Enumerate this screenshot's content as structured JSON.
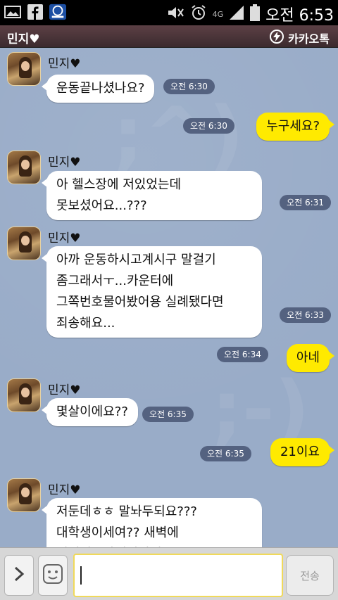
{
  "status": {
    "time": "오전 6:53",
    "network": "4G",
    "left_icons": [
      "image-icon",
      "facebook-icon",
      "news-app-icon"
    ],
    "right_icons": [
      "mute-icon",
      "alarm-icon",
      "signal-icon",
      "battery-icon"
    ]
  },
  "header": {
    "title": "민지♥",
    "app_name": "카카오톡",
    "app_icon": "kakaotalk-bolt-icon"
  },
  "messages": [
    {
      "sender": "민지♥",
      "text": "운동끝나셨나요?",
      "time": "오전 6:30"
    },
    {
      "sender": "me",
      "text": "누구세요?",
      "time": "오전 6:30"
    },
    {
      "sender": "민지♥",
      "text": "아 헬스장에 저있었는데\n못보셨어요...???",
      "time": "오전 6:31"
    },
    {
      "sender": "민지♥",
      "text": "아까 운동하시고계시구 말걸기\n좀그래서ㅜ...카운터에\n그쪽번호물어봤어용 실례됐다면\n죄송해요...",
      "time": "오전 6:33"
    },
    {
      "sender": "me",
      "text": "아네",
      "time": "오전 6:34"
    },
    {
      "sender": "민지♥",
      "text": "몇살이에요??",
      "time": "오전 6:35"
    },
    {
      "sender": "me",
      "text": "21이요",
      "time": "오전 6:35"
    },
    {
      "sender": "민지♥",
      "text": "저둔데ㅎㅎ 말놔두되요???\n대학생이세여?? 새벽에\n어쩌피트바에여덧데",
      "time": ""
    }
  ],
  "input": {
    "value": "",
    "send_label": "전송",
    "expand_icon": "chevron-right-icon",
    "emoticon_icon": "smiley-icon"
  },
  "colors": {
    "chat_bg": "#99acc8",
    "my_bubble": "#ffea00",
    "their_bubble": "#ffffff",
    "timestamp_pill": "#546280",
    "title_bar": "#4a3338"
  }
}
